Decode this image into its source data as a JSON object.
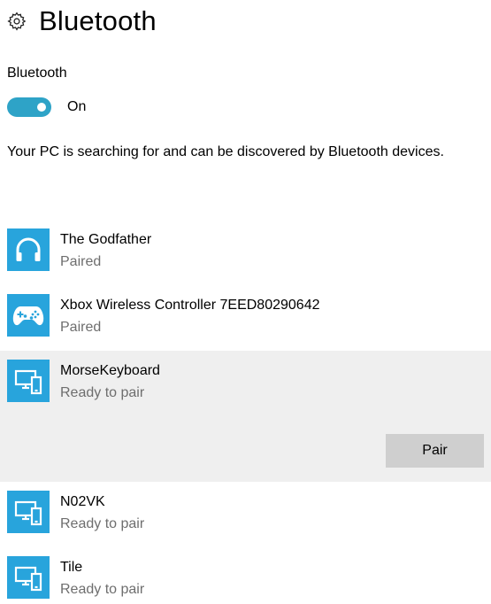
{
  "header": {
    "title": "Bluetooth",
    "icon": "gear-icon"
  },
  "bluetooth": {
    "label": "Bluetooth",
    "toggle_state": "On",
    "toggle_on": true,
    "accent_color": "#2ea3c7"
  },
  "description": "Your PC is searching for and can be discovered by Bluetooth devices.",
  "devices": [
    {
      "name": "The Godfather",
      "status": "Paired",
      "icon": "headphones-icon"
    },
    {
      "name": "Xbox Wireless Controller 7EED80290642",
      "status": "Paired",
      "icon": "gamepad-icon"
    },
    {
      "name": "MorseKeyboard",
      "status": "Ready to pair",
      "icon": "pc-phone-icon",
      "selected": true,
      "action_label": "Pair"
    },
    {
      "name": "N02VK",
      "status": "Ready to pair",
      "icon": "pc-phone-icon"
    },
    {
      "name": "Tile",
      "status": "Ready to pair",
      "icon": "pc-phone-icon"
    }
  ],
  "colors": {
    "device_icon_bg": "#28a4dc",
    "selected_row_bg": "#efefef",
    "secondary_text": "#6e6e6e"
  }
}
